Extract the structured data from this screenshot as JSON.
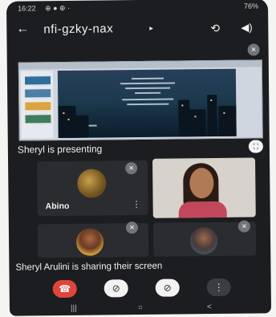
{
  "status_bar": {
    "time": "16:22",
    "left_icons": "⊕ ● ⊕ ·",
    "battery": "76%"
  },
  "app_bar": {
    "back_glyph": "←",
    "meeting_code": "nfi-gzky-nax",
    "caret_glyph": "▸",
    "switch_camera_glyph": "⟲",
    "speaker_glyph": "◀)"
  },
  "presentation": {
    "presenter_label": "Sheryl is presenting",
    "fullscreen_glyph": "⛶"
  },
  "participants": [
    {
      "name": "Abino",
      "more_glyph": "⋮",
      "muted": true
    },
    {
      "name": "",
      "muted": false
    },
    {
      "name": "",
      "muted": true
    },
    {
      "name": "",
      "muted": true
    }
  ],
  "share_banner": "Sheryl Arulini is sharing their screen",
  "controls": {
    "end_call_glyph": "☎",
    "camera_off_glyph": "⊘",
    "mic_off_glyph": "⊘",
    "more_glyph": "⋮"
  },
  "nav_bar": {
    "recents_glyph": "|||",
    "home_glyph": "○",
    "back_glyph": "<"
  },
  "colors": {
    "background": "#1c1d20",
    "tile": "#2b2c30",
    "end_call": "#e0453c",
    "control_light": "#f2f2f2",
    "control_dark": "#3c3d41"
  }
}
